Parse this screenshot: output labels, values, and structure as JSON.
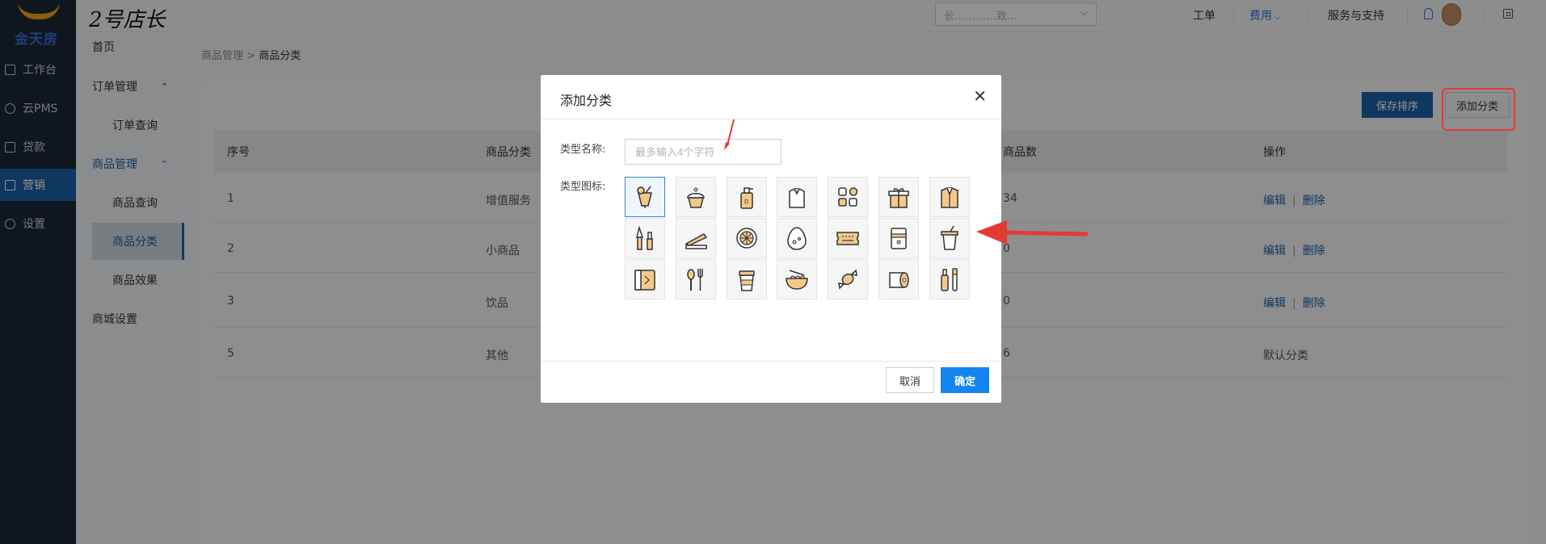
{
  "sidebar": {
    "logo_text": "金天房",
    "items": [
      {
        "label": "工作台",
        "icon": "desk-icon",
        "active": false
      },
      {
        "label": "云PMS",
        "icon": "cloud-icon",
        "active": false
      },
      {
        "label": "贷款",
        "icon": "loan-icon",
        "active": false
      },
      {
        "label": "营销",
        "icon": "marketing-icon",
        "active": true
      },
      {
        "label": "设置",
        "icon": "gear-icon",
        "active": false
      }
    ]
  },
  "topbar": {
    "brand": "2号店长",
    "select_value": "长…………致…",
    "links": [
      "工单",
      "费用",
      "服务与支持"
    ]
  },
  "menu": {
    "home": "首页",
    "orders": "订单管理",
    "order_query": "订单查询",
    "goods": "商品管理",
    "goods_query": "商品查询",
    "goods_category": "商品分类",
    "goods_effect": "商品效果",
    "mall_settings": "商城设置"
  },
  "breadcrumb": {
    "parent": "商品管理",
    "sep": " > ",
    "current": "商品分类"
  },
  "toolbar": {
    "save_order": "保存排序",
    "add_category": "添加分类"
  },
  "table": {
    "headers": [
      "序号",
      "商品分类",
      "商品数",
      "操作"
    ],
    "rows": [
      {
        "index": "1",
        "category": "增值服务",
        "count": "34",
        "edit": "编辑",
        "delete": "删除",
        "default": ""
      },
      {
        "index": "2",
        "category": "小商品",
        "count": "0",
        "edit": "编辑",
        "delete": "删除",
        "default": ""
      },
      {
        "index": "3",
        "category": "饮品",
        "count": "0",
        "edit": "编辑",
        "delete": "删除",
        "default": ""
      },
      {
        "index": "5",
        "category": "其他",
        "count": "6",
        "edit": "",
        "delete": "",
        "default": "默认分类"
      }
    ],
    "op_separator": "|"
  },
  "modal": {
    "title": "添加分类",
    "name_label": "类型名称:",
    "name_placeholder": "最多输入4个字符",
    "icon_label": "类型图标:",
    "cancel": "取消",
    "confirm": "确定",
    "icons": [
      [
        "cocktail-icon",
        "cupcake-icon",
        "lotion-bottle-icon",
        "shirt-bag-icon",
        "apps-grid-icon",
        "gift-box-icon",
        "suit-icon"
      ],
      [
        "makeup-brush-icon",
        "stapler-icon",
        "orange-slice-icon",
        "egg-icon",
        "ticket-icon",
        "packet-icon",
        "drink-cup-icon"
      ],
      [
        "card-icon",
        "spoon-fork-icon",
        "coffee-cup-icon",
        "noodle-bowl-icon",
        "candy-icon",
        "toilet-paper-icon",
        "toothbrush-icon"
      ]
    ],
    "selected_icon": "cocktail-icon"
  },
  "colors": {
    "accent": "#1c5fa6",
    "confirm": "#1485ee",
    "annotation": "#e53935",
    "icon_fill": "#f2c98a"
  }
}
